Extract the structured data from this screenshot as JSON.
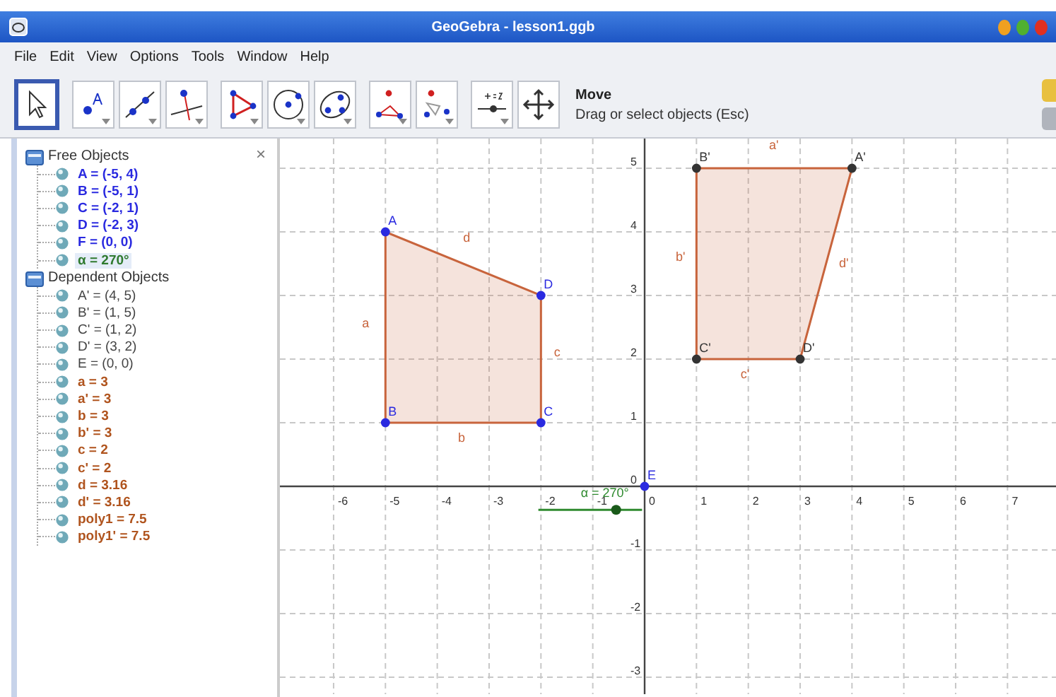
{
  "window": {
    "title": "GeoGebra - lesson1.ggb"
  },
  "menu": [
    "File",
    "Edit",
    "View",
    "Options",
    "Tools",
    "Window",
    "Help"
  ],
  "toolbar": {
    "tools": [
      {
        "kind": "move",
        "selected": true
      },
      {
        "kind": "point",
        "selected": false
      },
      {
        "kind": "line",
        "selected": false
      },
      {
        "kind": "perpendicular",
        "selected": false
      },
      {
        "kind": "polygon",
        "selected": false
      },
      {
        "kind": "circle",
        "selected": false
      },
      {
        "kind": "conic",
        "selected": false
      },
      {
        "kind": "reflect",
        "selected": false
      },
      {
        "kind": "dilate",
        "selected": false
      },
      {
        "kind": "slider",
        "selected": false
      },
      {
        "kind": "pan",
        "selected": false
      }
    ],
    "tool_name": "Move",
    "tool_help": "Drag or select objects (Esc)"
  },
  "algebra": {
    "close": "×",
    "groups": [
      {
        "label": "Free Objects",
        "children": [
          {
            "text": "A = (-5, 4)",
            "color": "#2a2ae0",
            "selected": false
          },
          {
            "text": "B = (-5, 1)",
            "color": "#2a2ae0",
            "selected": false
          },
          {
            "text": "C = (-2, 1)",
            "color": "#2a2ae0",
            "selected": false
          },
          {
            "text": "D = (-2, 3)",
            "color": "#2a2ae0",
            "selected": false
          },
          {
            "text": "F = (0, 0)",
            "color": "#2a2ae0",
            "selected": false
          },
          {
            "text": "α = 270°",
            "color": "#2f7a2f",
            "selected": true
          }
        ]
      },
      {
        "label": "Dependent Objects",
        "children": [
          {
            "text": "A' = (4, 5)",
            "color": "#444444",
            "selected": false
          },
          {
            "text": "B' = (1, 5)",
            "color": "#444444",
            "selected": false
          },
          {
            "text": "C' = (1, 2)",
            "color": "#444444",
            "selected": false
          },
          {
            "text": "D' = (3, 2)",
            "color": "#444444",
            "selected": false
          },
          {
            "text": "E = (0, 0)",
            "color": "#444444",
            "selected": false
          },
          {
            "text": "a = 3",
            "color": "#b0541e",
            "selected": false
          },
          {
            "text": "a' = 3",
            "color": "#b0541e",
            "selected": false
          },
          {
            "text": "b = 3",
            "color": "#b0541e",
            "selected": false
          },
          {
            "text": "b' = 3",
            "color": "#b0541e",
            "selected": false
          },
          {
            "text": "c = 2",
            "color": "#b0541e",
            "selected": false
          },
          {
            "text": "c' = 2",
            "color": "#b0541e",
            "selected": false
          },
          {
            "text": "d = 3.16",
            "color": "#b0541e",
            "selected": false
          },
          {
            "text": "d' = 3.16",
            "color": "#b0541e",
            "selected": false
          },
          {
            "text": "poly1 = 7.5",
            "color": "#b0541e",
            "selected": false
          },
          {
            "text": "poly1' = 7.5",
            "color": "#b0541e",
            "selected": false
          }
        ]
      }
    ]
  },
  "graphics": {
    "x_ticks": [
      "-6",
      "-5",
      "-4",
      "-3",
      "-2",
      "-1",
      "0",
      "1",
      "2",
      "3",
      "4",
      "5",
      "6",
      "7"
    ],
    "y_ticks": [
      "5",
      "4",
      "3",
      "2",
      "1",
      "0",
      "-1",
      "-2",
      "-3"
    ],
    "point_labels": [
      "B'",
      "A'",
      "A",
      "D",
      "C'",
      "D'",
      "B",
      "C",
      "E"
    ],
    "segment_labels": [
      "a'",
      "d",
      "b'",
      "d'",
      "a",
      "c",
      "c'",
      "b"
    ],
    "slider": {
      "label": "α = 270°",
      "level": 0.75
    }
  }
}
